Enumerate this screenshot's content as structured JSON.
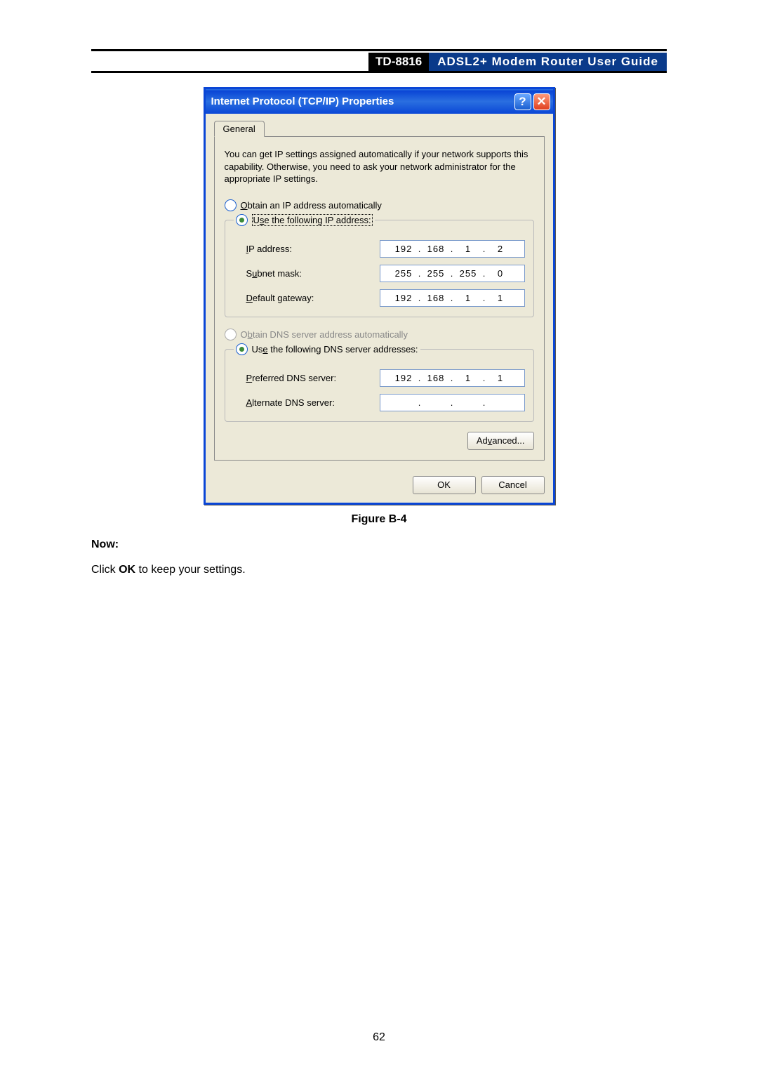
{
  "header": {
    "model": "TD-8816",
    "title": "ADSL2+  Modem  Router  User  Guide"
  },
  "dialog": {
    "title": "Internet Protocol (TCP/IP) Properties",
    "help_glyph": "?",
    "close_glyph": "✕",
    "tab_label": "General",
    "intro": "You can get IP settings assigned automatically if your network supports this capability. Otherwise, you need to ask your network administrator for the appropriate IP settings.",
    "ip_section": {
      "auto_label_pre": "O",
      "auto_label_post": "btain an IP address automatically",
      "manual_label_pre": "U",
      "manual_label_mid": "s",
      "manual_label_post": "e the following IP address:",
      "fields": {
        "ip_label_pre": "I",
        "ip_label_post": "P address:",
        "ip_value": [
          "192",
          "168",
          "1",
          "2"
        ],
        "subnet_label_pre": "S",
        "subnet_label_mid": "u",
        "subnet_label_post": "bnet mask:",
        "subnet_value": [
          "255",
          "255",
          "255",
          "0"
        ],
        "gateway_label_pre": "D",
        "gateway_label_post": "efault gateway:",
        "gateway_value": [
          "192",
          "168",
          "1",
          "1"
        ]
      }
    },
    "dns_section": {
      "auto_label_pre": "O",
      "auto_label_mid": "b",
      "auto_label_post": "tain DNS server address automatically",
      "manual_label_pre": "Us",
      "manual_label_mid": "e",
      "manual_label_post": " the following DNS server addresses:",
      "fields": {
        "preferred_label_pre": "P",
        "preferred_label_post": "referred DNS server:",
        "preferred_value": [
          "192",
          "168",
          "1",
          "1"
        ],
        "alternate_label_pre": "A",
        "alternate_label_post": "lternate DNS server:",
        "alternate_value": [
          "",
          "",
          "",
          ""
        ]
      }
    },
    "advanced_pre": "Ad",
    "advanced_mid": "v",
    "advanced_post": "anced...",
    "ok_label": "OK",
    "cancel_label": "Cancel"
  },
  "figure_caption": "Figure B-4",
  "now_label": "Now:",
  "instruction_pre": "Click ",
  "instruction_bold": "OK",
  "instruction_post": " to keep your settings.",
  "page_number": "62"
}
